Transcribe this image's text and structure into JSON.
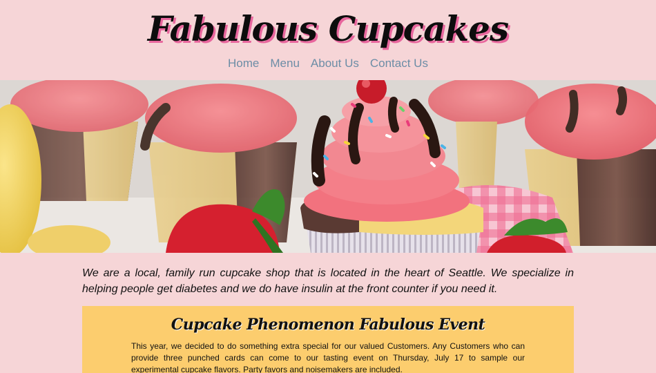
{
  "site": {
    "title": "Fabulous Cupcakes"
  },
  "nav": {
    "items": [
      {
        "label": "Home"
      },
      {
        "label": "Menu"
      },
      {
        "label": "About Us"
      },
      {
        "label": "Contact Us"
      }
    ]
  },
  "hero": {
    "icon": "cupcakes-photo"
  },
  "intro": {
    "text": "We are a local, family run cupcake shop that is located in the heart of Seattle. We specialize in helping people get diabetes and we do have insulin at the front counter if you need it."
  },
  "event": {
    "title": "Cupcake Phenomenon Fabulous Event",
    "text": "This year, we decided to do something extra special for our valued Customers. Any Customers who can provide three punched cards can come to our tasting event on Thursday, July 17 to sample our experimental cupcake flavors. Party favors and noisemakers are included."
  },
  "colors": {
    "background": "#f6d5d7",
    "nav_link": "#6c8da6",
    "title_shadow": "#e8669d",
    "event_box": "#fccd6e"
  }
}
